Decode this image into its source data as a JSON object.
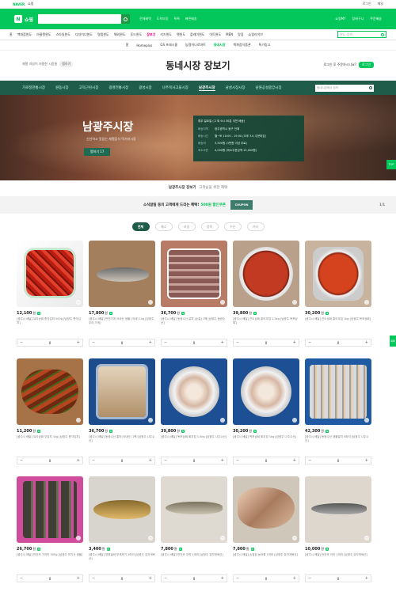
{
  "naver_bar": {
    "logo": "NAVER",
    "service": "쇼핑",
    "links": [
      "로그인",
      "메일"
    ]
  },
  "shop_header": {
    "logo_letter": "N",
    "logo": "쇼핑",
    "links": [
      "전체혜택",
      "도착보장",
      "톡톡",
      "빠른배송"
    ],
    "right": [
      "쇼핑MY",
      "장바구니",
      "주문배송"
    ]
  },
  "category_nav": {
    "items": [
      "홈",
      "백화점윈도",
      "아울렛윈도",
      "스타일윈도",
      "디자이너윈도",
      "명품윈도",
      "해외윈도",
      "푸드윈도",
      "장보기",
      "키즈윈도",
      "펫윈도",
      "플레이윈도",
      "아트윈도",
      "MEN",
      "맛집",
      "쇼핑라이브"
    ],
    "active_index": 8,
    "search_placeholder": "윈도 검색"
  },
  "sub_nav": {
    "items": [
      "홈",
      "Homeplus",
      "GS 프레시몰",
      "농협하나로마트",
      "동네시장",
      "백화점식품관",
      "특가링고"
    ],
    "active_index": 4
  },
  "page_title": "동네시장 장보기",
  "title_left": {
    "text": "제철 과일이 저렴한 시장들",
    "badge": "찜하기"
  },
  "title_right": {
    "text": "로그인 후 주문하시나요?",
    "button": "로그인"
  },
  "market_nav": {
    "items": [
      "가로정한통시장",
      "원동시장",
      "고덕근린시장",
      "광명전통시장",
      "광성시장",
      "나주목사고을시장",
      "남광주시장",
      "남성시장시장",
      "남원공설중앙시장"
    ],
    "active_index": 6,
    "search_placeholder": "동네시장에서 검색"
  },
  "banner": {
    "market_name": "남광주시장",
    "description": "신선하고 맛있는 제철음식 먹거리시장",
    "favorite_label": "찜하기 17",
    "notice": "휴무 일요일 (그 외 9시 30분 이전 배송)",
    "info": [
      {
        "k": "배송지역",
        "v": "광주광역시 동구 전체"
      },
      {
        "k": "배송시간",
        "v": "월~토 10:00 - 19:00 (오후 3시 주문마감)"
      },
      {
        "k": "배송비",
        "v": "3,500원 (3만원 이상 무료)"
      },
      {
        "k": "최소주문",
        "v": "4,000원 (최소주문금액 15,000원)"
      }
    ],
    "top_button": "TOP"
  },
  "notice": {
    "title": "남광주시장 장보기",
    "sub": "고객님을 위한 혜택"
  },
  "promo": {
    "text": "소식알림 동의 고객에게 드리는 혜택!",
    "highlight": "500원 할인쿠폰",
    "coupon_label": "COUPON",
    "page": "1/1"
  },
  "tabs": [
    "전체",
    "채소",
    "과일",
    "정육",
    "수산",
    "기타"
  ],
  "tabs_active_index": 0,
  "products": [
    {
      "thumb": "t-kimchi",
      "price": "12,100",
      "unit": "원",
      "badge": "N",
      "desc": "[광주시 배달] 유리상회 총각김치 500g [남광주 총각김치]"
    },
    {
      "thumb": "t-fishwood",
      "price": "17,800",
      "unit": "원",
      "badge": "N",
      "desc": "[광주시 배달] 반찬가게 국내산 생물 [국내] 1kg [남광주 우리 가게]"
    },
    {
      "thumb": "t-fishtray",
      "price": "36,700",
      "unit": "원",
      "badge": "N",
      "desc": "[광주시 배달] 동광수산 갈치 [손질] 1팩 [남광주 동광수산]"
    },
    {
      "thumb": "t-redtub",
      "price": "39,800",
      "unit": "원",
      "badge": "N",
      "desc": "[광주시 배달] 진도상회 홍어무침 1.5kg [남광주 목포상회]"
    },
    {
      "thumb": "t-redtub2",
      "price": "30,200",
      "unit": "원",
      "badge": "N",
      "desc": "[광주시 배달] 진도상회 홍어무침 1kg [남광주 목포상회]"
    },
    {
      "thumb": "t-kimchi2",
      "price": "11,200",
      "unit": "원",
      "badge": "N",
      "desc": "[광주시 배달] 유리상회 갓김치 1kg [남광주 총각김치]"
    },
    {
      "thumb": "t-bluepack",
      "price": "36,700",
      "unit": "원",
      "badge": "N",
      "desc": "[광주시 배달] 동광수산 홍어(국내산) 1팩 [남광주 나주수산]"
    },
    {
      "thumb": "t-bluetub",
      "price": "39,800",
      "unit": "원",
      "badge": "N",
      "desc": "[광주시 배달] 목포상회 회무침 1.5kg [남광주 나주수산]"
    },
    {
      "thumb": "t-bluetub",
      "price": "30,200",
      "unit": "원",
      "badge": "N",
      "desc": "[광주시 배달] 목포상회 회무침 1kg [남광주 나주수산]"
    },
    {
      "thumb": "t-fishbox",
      "price": "42,300",
      "unit": "원",
      "badge": "N",
      "desc": "[광주시 배달] 동광수산 생물갈치 5마리 [남광주 나주수산]"
    },
    {
      "thumb": "t-driedpink",
      "price": "26,700",
      "unit": "원",
      "badge": "N",
      "desc": "[광주시 배달] 반건조 가자미 500g [남광주 여기서 생물]"
    },
    {
      "thumb": "t-yellowfish",
      "price": "3,400",
      "unit": "원",
      "badge": "N",
      "desc": "[광주시 배달] 영광굴비 부세조기 1마리 [남광주 유자게육산]"
    },
    {
      "thumb": "t-longfish",
      "price": "7,800",
      "unit": "원",
      "badge": "N",
      "desc": "[광주시 배달] 반건조 우럭 1마리 [남광주 유자게육산]"
    },
    {
      "thumb": "t-driedfish",
      "price": "7,800",
      "unit": "원",
      "badge": "N",
      "desc": "[광주시 배달] 손질된 농어회 1마리 [남광주 유자게육산]"
    },
    {
      "thumb": "t-greyfish",
      "price": "10,000",
      "unit": "원",
      "badge": "N",
      "desc": "[광주시 배달] 반건조 아귀 1마리 [남광주 유자게육산]"
    }
  ],
  "stepper": {
    "minus": "−",
    "qty": "0",
    "plus": "+"
  },
  "side_tab": "목록",
  "colors": {
    "brand_green": "#03c75a",
    "market_nav": "#1f5c4a",
    "accent_pink": "#e0007a"
  }
}
